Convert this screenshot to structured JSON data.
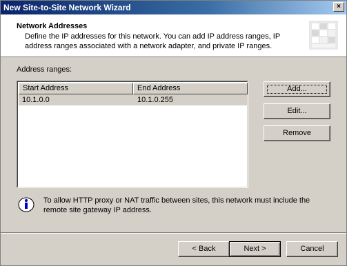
{
  "window": {
    "title": "New Site-to-Site Network Wizard",
    "close_glyph": "×"
  },
  "header": {
    "title": "Network Addresses",
    "description": "Define the IP addresses for this network. You can add IP address ranges, IP address ranges associated with a network adapter, and private IP ranges."
  },
  "address_ranges": {
    "label": "Address ranges:",
    "columns": [
      "Start Address",
      "End Address"
    ],
    "rows": [
      {
        "start": "10.1.0.0",
        "end": "10.1.0.255"
      }
    ]
  },
  "buttons": {
    "add": "Add...",
    "edit": "Edit...",
    "remove": "Remove"
  },
  "info": {
    "icon": "info-icon",
    "text": "To allow HTTP proxy or NAT traffic between sites, this network must include the remote site gateway IP address."
  },
  "footer": {
    "back": "< Back",
    "next": "Next >",
    "cancel": "Cancel"
  }
}
